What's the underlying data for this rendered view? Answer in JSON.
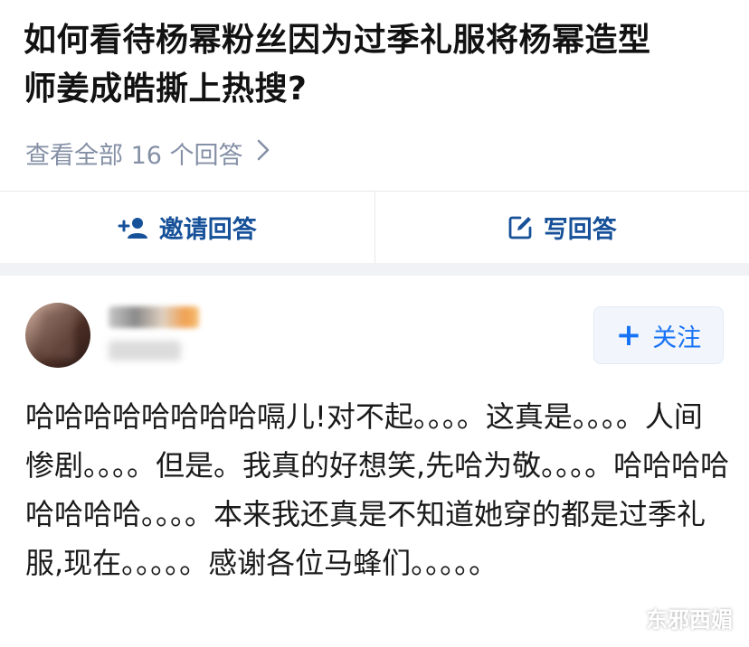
{
  "question": {
    "title_line1": "如何看待杨幂粉丝因为过季礼服将杨幂造型",
    "title_line2": "师姜成皓撕上热搜?",
    "view_all": "查看全部 16 个回答"
  },
  "actions": {
    "invite_label": "邀请回答",
    "write_label": "写回答"
  },
  "author": {
    "follow_label": "关注"
  },
  "answer": {
    "text": "哈哈哈哈哈哈哈哈嗝儿!对不起。。。。这真是。。。。人间惨剧。。。。但是。我真的好想笑,先哈为敬。。。。哈哈哈哈哈哈哈哈。。。。本来我还真是不知道她穿的都是过季礼服,现在。。。。。感谢各位马蜂们。。。。。"
  },
  "watermark": {
    "label": "东邪西媚"
  },
  "colors": {
    "accent": "#175199",
    "follow": "#1772f6",
    "muted": "#8590a6"
  },
  "icons": {
    "invite": "add-user-icon",
    "write": "edit-icon",
    "watermark": "wechat-icon"
  }
}
